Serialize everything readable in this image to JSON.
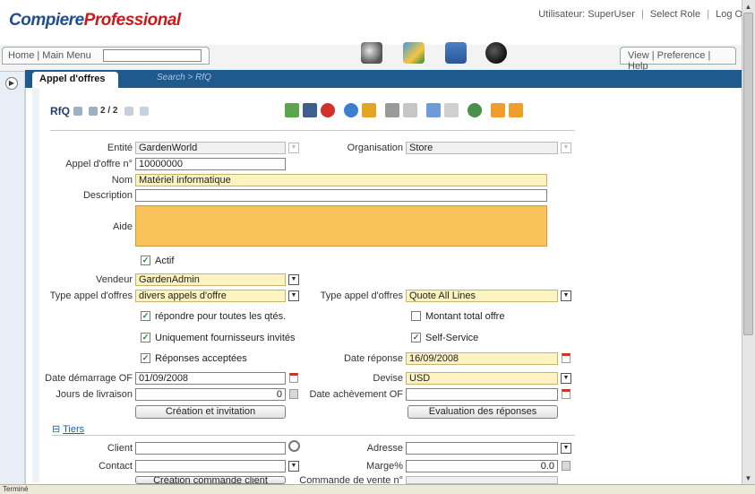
{
  "header": {
    "logo_part1": "Compiere",
    "logo_part2": "Professional",
    "user_label": "Utilisateur: SuperUser",
    "select_role": "Select Role",
    "logout": "Log Off"
  },
  "nav": {
    "left_text": "Home | Main Menu",
    "right_text": "View | Preference | Help"
  },
  "tab": {
    "active_label": "Appel d'offres",
    "breadcrumb": "Search > RfQ"
  },
  "toolbar": {
    "title": "RfQ",
    "record_counter": "2 / 2"
  },
  "form": {
    "entite_label": "Entité",
    "entite_value": "GardenWorld",
    "organisation_label": "Organisation",
    "organisation_value": "Store",
    "appel_no_label": "Appel d'offre n°",
    "appel_no_value": "10000000",
    "nom_label": "Nom",
    "nom_value": "Matériel informatique",
    "description_label": "Description",
    "description_value": "",
    "aide_label": "Aide",
    "actif_label": "Actif",
    "vendeur_label": "Vendeur",
    "vendeur_value": "GardenAdmin",
    "type_appel_label": "Type appel d'offres",
    "type_appel_value": "divers appels d'offre",
    "type_appel2_label": "Type appel d'offres",
    "type_appel2_value": "Quote All Lines",
    "repondre_label": "répondre pour toutes les qtés.",
    "montant_label": "Montant total offre",
    "fournisseurs_label": "Uniquement fournisseurs invités",
    "selfservice_label": "Self-Service",
    "reponses_label": "Réponses acceptées",
    "date_reponse_label": "Date réponse",
    "date_reponse_value": "16/09/2008",
    "date_demarrage_label": "Date démarrage OF",
    "date_demarrage_value": "01/09/2008",
    "devise_label": "Devise",
    "devise_value": "USD",
    "jours_label": "Jours de livraison",
    "jours_value": "0",
    "date_achevement_label": "Date achèvement OF",
    "date_achevement_value": "",
    "btn_creation": "Création et invitation",
    "btn_evaluation": "Evaluation des réponses",
    "tiers_toggle": "⊟",
    "tiers_label": "Tiers",
    "client_label": "Client",
    "adresse_label": "Adresse",
    "contact_label": "Contact",
    "marge_label": "Marge%",
    "marge_value": "0.0",
    "btn_commande": "Création commande client",
    "commande_vente_label": "Commande de vente n°"
  },
  "status": {
    "text": "Terminé"
  },
  "colors": {
    "accent": "#1e5a8c",
    "required_field": "#fdf3c1",
    "aide_field": "#f9c25a"
  }
}
